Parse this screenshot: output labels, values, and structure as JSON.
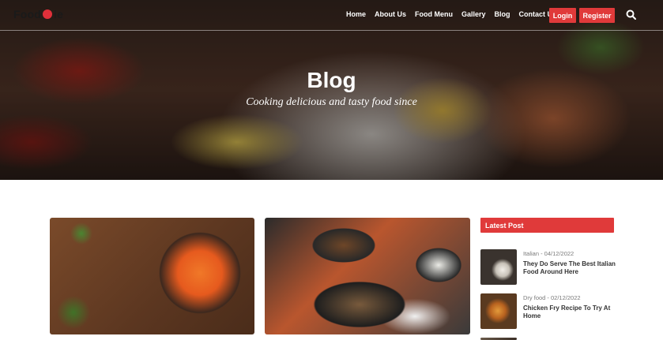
{
  "nav": {
    "logo_text": "Food",
    "logo_suffix": "ie",
    "links": [
      "Home",
      "About Us",
      "Food Menu",
      "Gallery",
      "Blog",
      "Contact Us"
    ],
    "login_label": "Login",
    "register_label": "Register",
    "search_icon": "search-icon"
  },
  "hero": {
    "title": "Blog",
    "subtitle": "Cooking delicious and tasty food since"
  },
  "sidebar": {
    "header": "Latest Post",
    "posts": [
      {
        "category_date": "Italian - 04/12/2022",
        "title": "They Do Serve The Best Italian Food Around Here"
      },
      {
        "category_date": "Dry food - 02/12/2022",
        "title": "Chicken Fry Recipe To Try At Home"
      },
      {
        "category_date": "",
        "title": ""
      }
    ]
  },
  "colors": {
    "accent": "#e03a3a",
    "text_dark": "#333333",
    "text_muted": "#7a7a7a"
  }
}
